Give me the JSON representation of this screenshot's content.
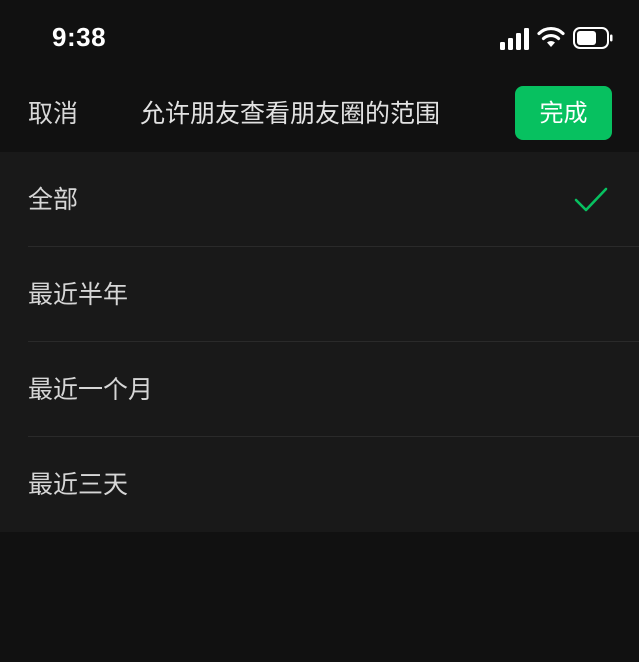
{
  "status_bar": {
    "time": "9:38"
  },
  "nav": {
    "cancel_label": "取消",
    "title": "允许朋友查看朋友圈的范围",
    "done_label": "完成"
  },
  "options": [
    {
      "label": "全部",
      "selected": true
    },
    {
      "label": "最近半年",
      "selected": false
    },
    {
      "label": "最近一个月",
      "selected": false
    },
    {
      "label": "最近三天",
      "selected": false
    }
  ],
  "colors": {
    "accent": "#07c160",
    "background": "#111111",
    "list_background": "#191919",
    "text": "#d8d8d8"
  },
  "icons": {
    "signal": "cellular-signal-icon",
    "wifi": "wifi-icon",
    "battery": "battery-icon",
    "selected": "checkmark-icon"
  }
}
